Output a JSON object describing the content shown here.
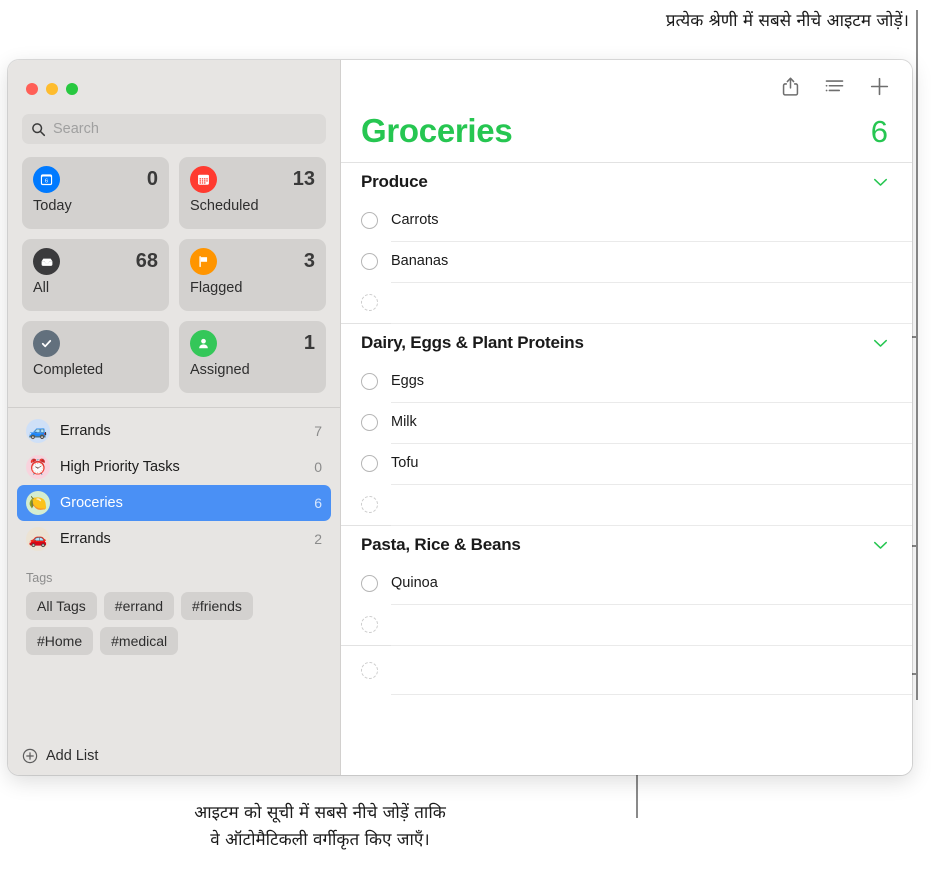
{
  "callouts": {
    "top": "प्रत्येक श्रेणी में सबसे नीचे आइटम जोड़ें।",
    "bottom_line1": "आइटम को सूची में सबसे नीचे जोड़ें ताकि",
    "bottom_line2": "वे ऑटोमैटिकली वर्गीकृत किए जाएँ।"
  },
  "sidebar": {
    "search": {
      "placeholder": "Search",
      "value": "",
      "icon": "search-icon"
    },
    "smart_lists": [
      {
        "label": "Today",
        "count": "0",
        "icon": "calendar-day-icon",
        "color": "#007aff"
      },
      {
        "label": "Scheduled",
        "count": "13",
        "icon": "calendar-icon",
        "color": "#ff3b30"
      },
      {
        "label": "All",
        "count": "68",
        "icon": "inbox-tray-icon",
        "color": "#3b3b3d"
      },
      {
        "label": "Flagged",
        "count": "3",
        "icon": "flag-icon",
        "color": "#ff9500"
      },
      {
        "label": "Completed",
        "count": "",
        "icon": "checkmark-icon",
        "color": "#62707d"
      },
      {
        "label": "Assigned",
        "count": "1",
        "icon": "person-icon",
        "color": "#34c759"
      }
    ],
    "lists": [
      {
        "name": "Errands",
        "count": "7",
        "emoji": "🚙",
        "selected": false
      },
      {
        "name": "High Priority Tasks",
        "count": "0",
        "emoji": "⏰",
        "selected": false
      },
      {
        "name": "Groceries",
        "count": "6",
        "emoji": "🍋",
        "selected": true
      },
      {
        "name": "Errands",
        "count": "2",
        "emoji": "🚗",
        "selected": false
      }
    ],
    "tags_title": "Tags",
    "tags": [
      "All Tags",
      "#errand",
      "#friends",
      "#Home",
      "#medical"
    ],
    "add_list_label": "Add List"
  },
  "main": {
    "toolbar": [
      {
        "name": "share-icon"
      },
      {
        "name": "sort-list-icon"
      },
      {
        "name": "add-reminder-icon"
      }
    ],
    "title": "Groceries",
    "total": "6",
    "accent_color": "#26c651",
    "sections": [
      {
        "name": "Produce",
        "collapse_icon": "chevron-down-icon",
        "tasks": [
          "Carrots",
          "Bananas"
        ],
        "new_item_placeholder": ""
      },
      {
        "name": "Dairy, Eggs & Plant Proteins",
        "collapse_icon": "chevron-down-icon",
        "tasks": [
          "Eggs",
          "Milk",
          "Tofu"
        ],
        "new_item_placeholder": ""
      },
      {
        "name": "Pasta, Rice & Beans",
        "collapse_icon": "chevron-down-icon",
        "tasks": [
          "Quinoa"
        ],
        "new_item_placeholder": ""
      }
    ],
    "bottom_new_item_placeholder": ""
  }
}
